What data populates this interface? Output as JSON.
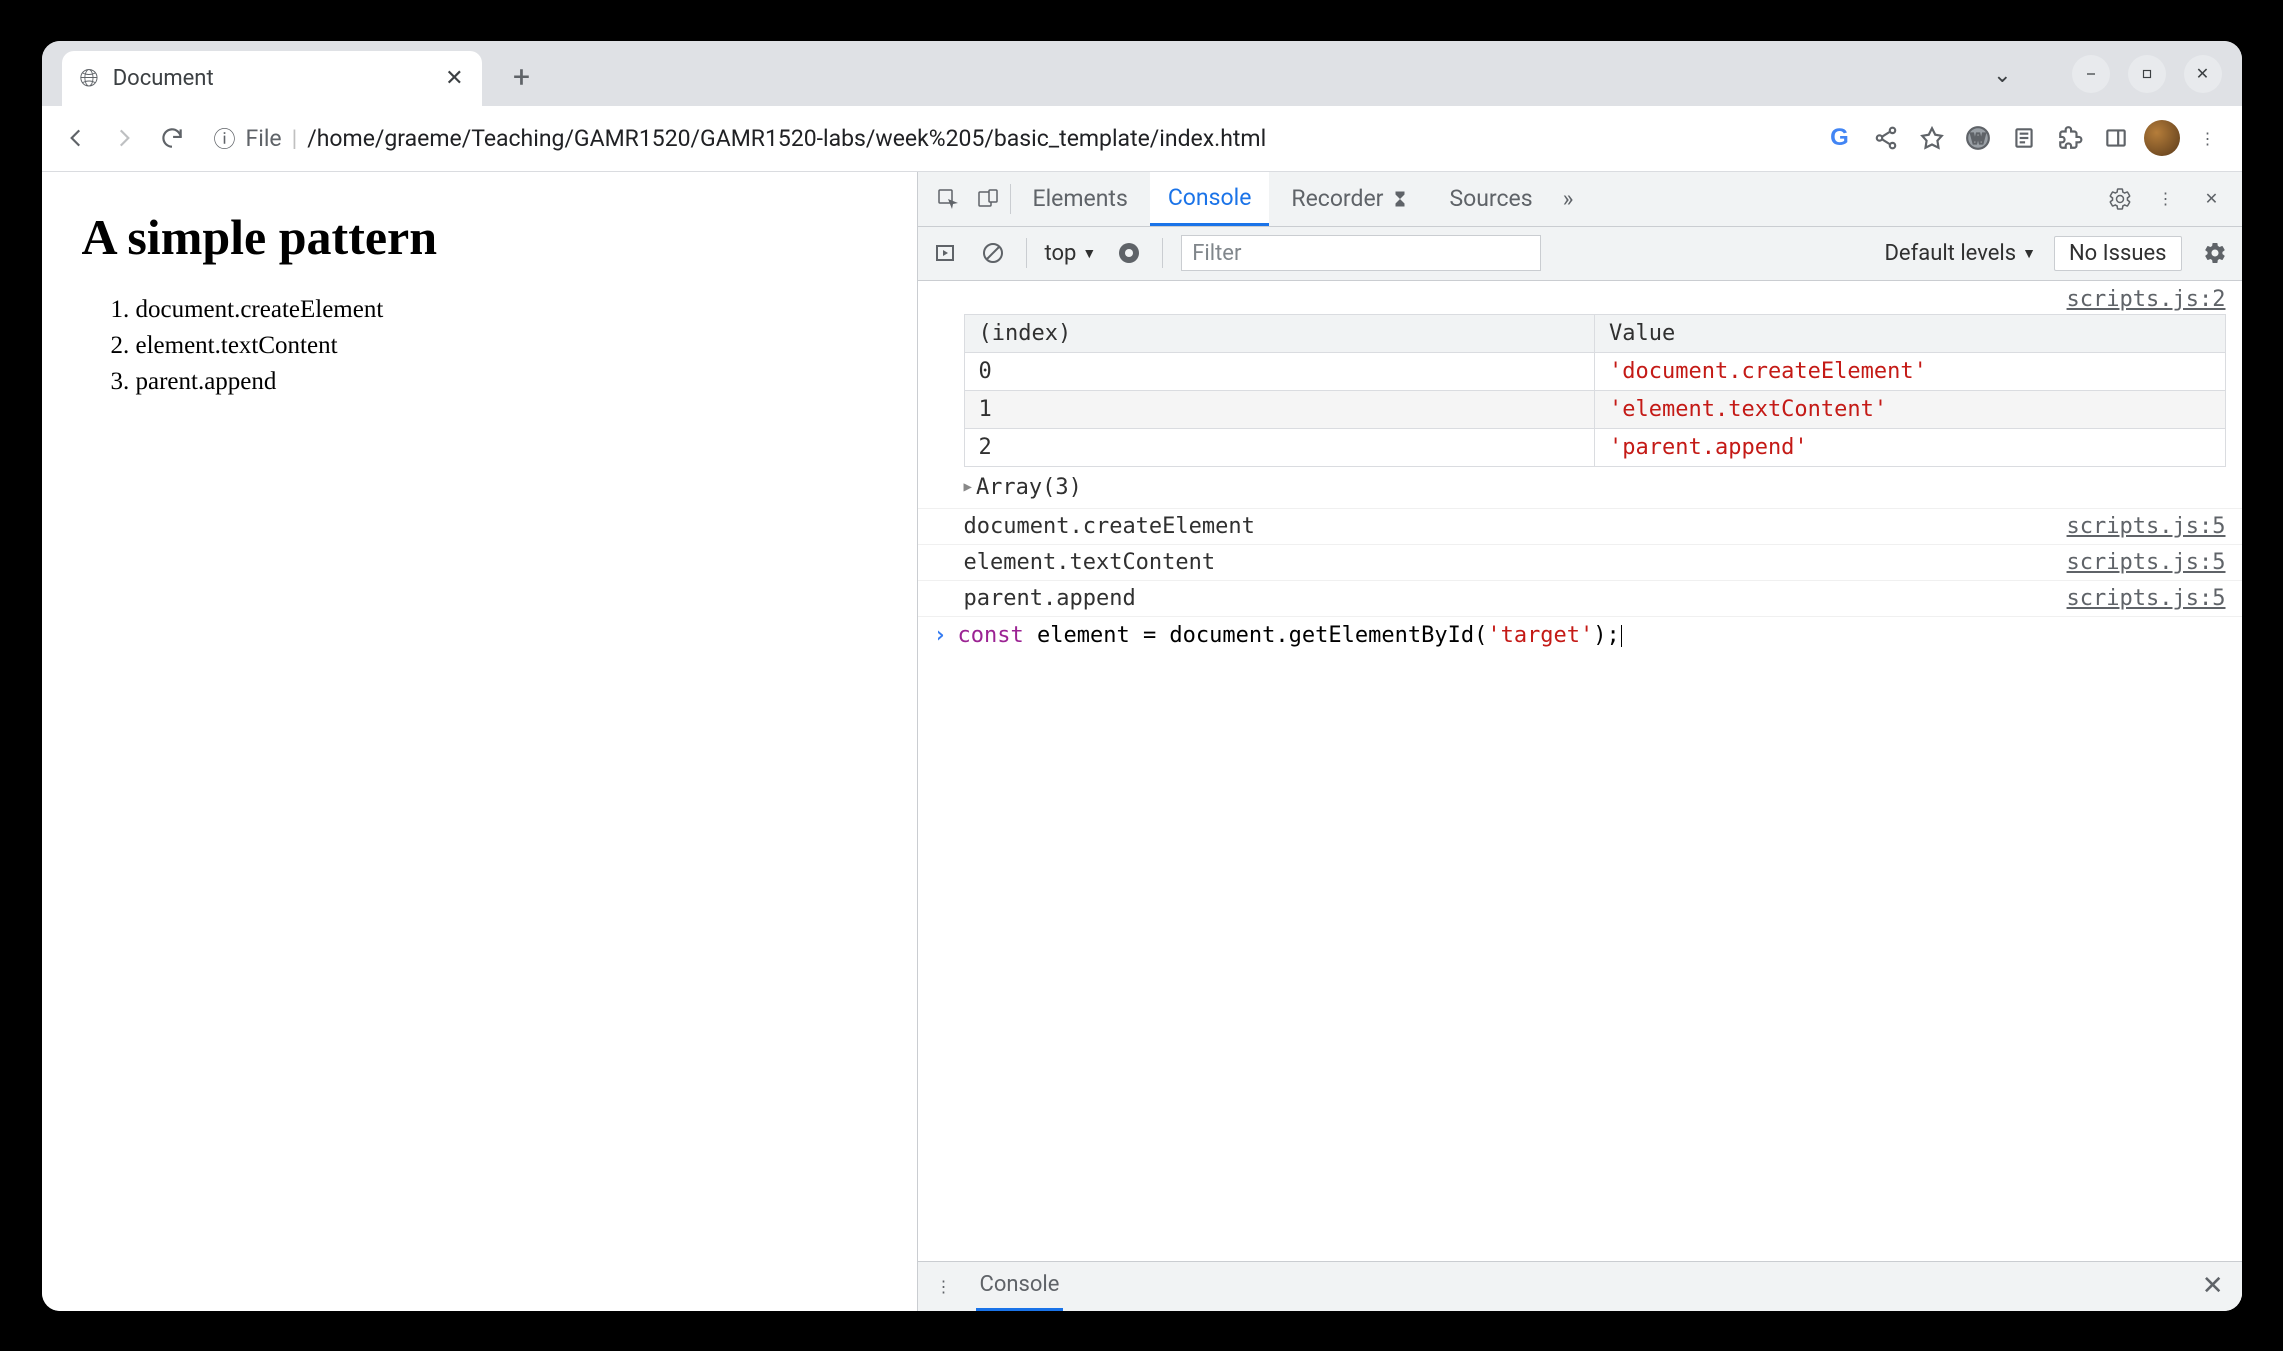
{
  "tab": {
    "title": "Document"
  },
  "address": {
    "scheme": "File",
    "path": "/home/graeme/Teaching/GAMR1520/GAMR1520-labs/week%205/basic_template/index.html"
  },
  "page": {
    "heading": "A simple pattern",
    "list": [
      "document.createElement",
      "element.textContent",
      "parent.append"
    ]
  },
  "devtools": {
    "tabs": {
      "elements": "Elements",
      "console": "Console",
      "recorder": "Recorder",
      "sources": "Sources"
    },
    "subbar": {
      "context": "top",
      "filter_placeholder": "Filter",
      "levels": "Default levels",
      "issues": "No Issues"
    },
    "table_source": "scripts.js:2",
    "table": {
      "headers": {
        "index": "(index)",
        "value": "Value"
      },
      "rows": [
        {
          "idx": "0",
          "val": "'document.createElement'"
        },
        {
          "idx": "1",
          "val": "'element.textContent'"
        },
        {
          "idx": "2",
          "val": "'parent.append'"
        }
      ]
    },
    "array_expand": "Array(3)",
    "logs": [
      {
        "msg": "document.createElement",
        "src": "scripts.js:5"
      },
      {
        "msg": "element.textContent",
        "src": "scripts.js:5"
      },
      {
        "msg": "parent.append",
        "src": "scripts.js:5"
      }
    ],
    "prompt": {
      "kw": "const",
      "rest1": " element = document.getElementById(",
      "str": "'target'",
      "rest2": ");"
    },
    "drawer": {
      "console": "Console"
    }
  }
}
